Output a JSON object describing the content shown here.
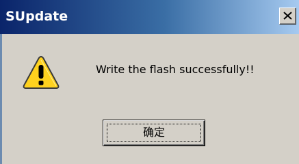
{
  "dialog": {
    "title": "SUpdate",
    "message": "Write the flash successfully!!",
    "ok_label": "确定",
    "icon": "warning-icon"
  },
  "colors": {
    "title_gradient_start": "#0a246a",
    "title_gradient_end": "#a6caf0",
    "face": "#d4d0c8",
    "warning_yellow": "#ffd21e"
  }
}
